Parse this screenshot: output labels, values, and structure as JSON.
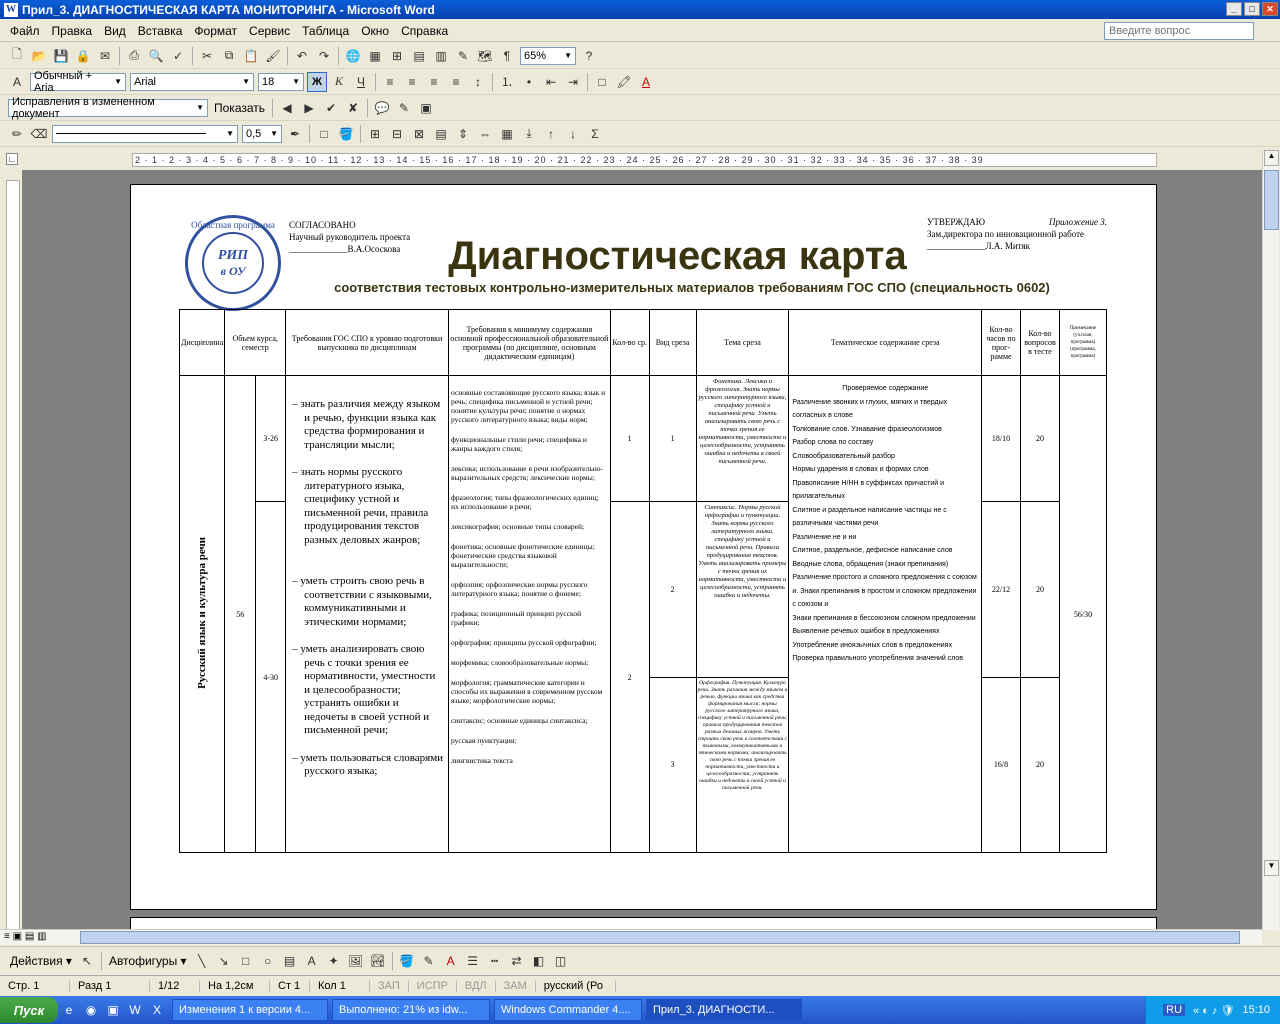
{
  "window": {
    "title": "Прил_3. ДИАГНОСТИЧЕСКАЯ КАРТА МОНИТОРИНГА - Microsoft Word",
    "app_icon": "word-icon"
  },
  "menu": [
    "Файл",
    "Правка",
    "Вид",
    "Вставка",
    "Формат",
    "Сервис",
    "Таблица",
    "Окно",
    "Справка"
  ],
  "ask_placeholder": "Введите вопрос",
  "toolbar": {
    "zoom": "65%",
    "style": "Обычный + Aria",
    "font": "Arial",
    "size": "18",
    "bold": "Ж",
    "italic": "К",
    "underline": "Ч",
    "track_mode": "Исправления в измененном документ",
    "show_label": "Показать",
    "line_weight": "0,5"
  },
  "ruler_start": "2",
  "document": {
    "stamp": {
      "ring_text": "Областная программа",
      "center1": "РИП",
      "center2": "в ОУ"
    },
    "agreed": {
      "title": "СОГЛАСОВАНО",
      "role": "Научный руководитель проекта",
      "signature": "_____________В.А.Ососкова"
    },
    "approved": {
      "appendix": "Приложение 3.",
      "title": "УТВЕРЖДАЮ",
      "role": "Зам.директора по инновационной работе",
      "signature": "_____________Л.А. Митяк"
    },
    "title": "Диагностическая карта",
    "subtitle": "соответствия тестовых контрольно-измерительных материалов требованиям ГОС СПО  (специальность 0602)",
    "headers": {
      "discipline": "Дисциплина",
      "volume": "Объем курса, семестр",
      "req": "Требования ГОС СПО к уровню подготовки выпускника по дисциплинам",
      "minimum": "Требования к минимуму содержания основной профессиональной образовательной программы (по дисциплине, основным дидактическим единицам)",
      "cuts": "Кол-во ср.",
      "cut_type": "Вид среза",
      "theme": "Тема среза",
      "content": "Тематическое содержание среза",
      "hours": "Кол-во часов по прог-рамме",
      "questions": "Кол-во вопросов в тесте",
      "note": "Примечание (уч.план, программа) (программа, программа)"
    },
    "discipline": "Русский язык и культура речи",
    "volume": "56",
    "sem1": "3-26",
    "sem2": "4-30",
    "requirements": [
      "знать различия между языком и речью, функции языка как средства формирования и трансляции мысли;",
      "знать  нормы русского литературного языка, специфику устной и письменной речи, правила продуцирования текстов разных деловых жанров;",
      "уметь строить свою речь в соответствии с языковыми, коммуникативными и этическими нормами;",
      "уметь анализировать свою речь с точки зрения ее нормативности, уместности и целесообразности; устранять ошибки и недочеты в своей устной и письменной речи;",
      "уметь пользоваться словарями русского языка;"
    ],
    "minimum": [
      "основные составляющие русского языка; язык и речь; специфика письменной и устной речи; понятие культуры речи; понятие о нормах русского литературного языка; виды норм;",
      "функциональные стили речи; специфика и жанры каждого стиля;",
      "лексика; использование в речи изобразительно-выразительных средств; лексические нормы;",
      "фразеология; типы фразеологических единиц; их использование в речи;",
      "лексикография; основные типы словарей;",
      "фонетика; основные фонетические единицы; фонетические средства языковой выразительности;",
      "орфоэпия; орфоэпические нормы русского литературного языка; понятие о фонеме;",
      "графика; позиционный принцип русской графики;",
      "орфография; принципы русской орфографии;",
      "морфемика; словообразовательные нормы;",
      "морфология; грамматические категории и способы их выражения в современном русском языке; морфологические нормы;",
      "синтаксис; основные единицы синтаксиса;",
      "русская пунктуация;",
      "лингвистика текста"
    ],
    "cuts": [
      "1",
      "2"
    ],
    "cut_types": [
      "1",
      "2",
      "3"
    ],
    "themes": [
      "Фонетика. Лексика и фразеология. Знать нормы русского литературного языка, специфику устной и письменной речи. Уметь анализировать свою речь с точки зрения ее нормативности, уместности и целесообразности, устранять ошибки и недочеты в своей письменной речи.",
      "Синтаксис. Нормы русской орфографии и пунктуации. Знать нормы русского литературного языка, специфику устной и письменной речи. Правила продуцирования текстов. Уметь анализировать примеры с точки зрения их нормативности, уместности и целесообразности, устранять ошибки и недочеты.",
      "Орфография. Пунктуация. Культура речи. Знать различия между языком и речью, функции языка как средства формирования мысли; нормы русского литературного языка, специфику устной и письменной речи; правила продуцирования текстов разных деловых жанров. Уметь строить свою речь в соответствии с языковыми, коммуникативными и этическими нормами; анализировать свою речь с точки зрения ее нормативности, уместности и целесообразности; устранять ошибки и недочеты в своей устной и письменной речи."
    ],
    "content_title": "Проверяемое содержание",
    "content": [
      "Различение звонких и глухих, мягких и твердых согласных в слове",
      "Толкование слов. Узнавание фразеологизмов",
      "Разбор слова по составу",
      "Словообразовательный разбор",
      "Нормы ударения в словах и формах слов",
      "Правописание Н/НН в суффиксах причастий и прилагательных",
      "Слитное и раздельное написание частицы не с различными частями речи",
      "Различение не и ни",
      "Слитное, раздельное, дефисное написание слов",
      "Вводные слова, обращения (знаки препинания)",
      "Различение простого и сложного предложения с союзом и. Знаки препинания в простом и сложном предложении с союзом и",
      "Знаки препинания в бессоюзном сложном предложении",
      "Выявление речевых ошибок в предложениях",
      "Употребление иноязычных слов в предложениях",
      "Проверка правильного употребления значений слов"
    ],
    "hours": [
      "18/10",
      "22/12",
      "16/8"
    ],
    "questions": [
      "20",
      "20",
      "20"
    ],
    "note": "56/30"
  },
  "drawbar": {
    "actions": "Действия",
    "autoshapes": "Автофигуры"
  },
  "status": {
    "page": "Стр. 1",
    "section": "Разд 1",
    "pages": "1/12",
    "at": "На 1,2см",
    "line": "Ст 1",
    "col": "Кол 1",
    "rec": "ЗАП",
    "trk": "ИСПР",
    "ext": "ВДЛ",
    "ovr": "ЗАМ",
    "lang": "русский (Ро"
  },
  "taskbar": {
    "start": "Пуск",
    "tasks": [
      "Изменения 1 к версии 4...",
      "Выполнено: 21% из idw...",
      "Windows Commander 4....",
      "Прил_3. ДИАГНОСТИ..."
    ],
    "lang": "RU",
    "clock": "15:10"
  }
}
